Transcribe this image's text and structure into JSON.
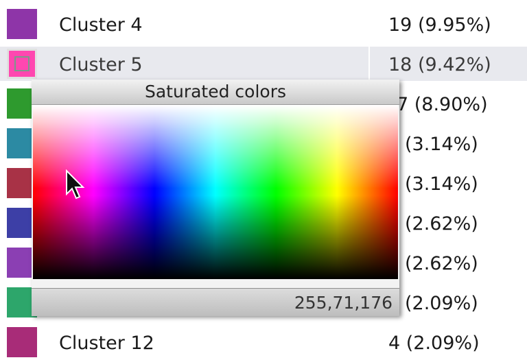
{
  "clusters": [
    {
      "name": "Cluster 4",
      "count": "19 (9.95%)",
      "color": "#8e35a8"
    },
    {
      "name": "Cluster 5",
      "count": "18 (9.42%)",
      "color": "#ff47b0",
      "selected": true
    },
    {
      "name": "",
      "count": "7 (8.90%)",
      "color": "#2e9a2e"
    },
    {
      "name": "",
      "count": "(3.14%)",
      "color": "#2c8aa3"
    },
    {
      "name": "",
      "count": "(3.14%)",
      "color": "#a83246"
    },
    {
      "name": "",
      "count": "(2.62%)",
      "color": "#3d3fa6"
    },
    {
      "name": "",
      "count": "(2.62%)",
      "color": "#8b3fb3"
    },
    {
      "name": "",
      "count": "(2.09%)",
      "color": "#2da66b"
    },
    {
      "name": "Cluster 12",
      "count": "4 (2.09%)",
      "color": "#a82c78"
    }
  ],
  "color_picker": {
    "title": "Saturated colors",
    "rgb_value": "255,71,176"
  }
}
